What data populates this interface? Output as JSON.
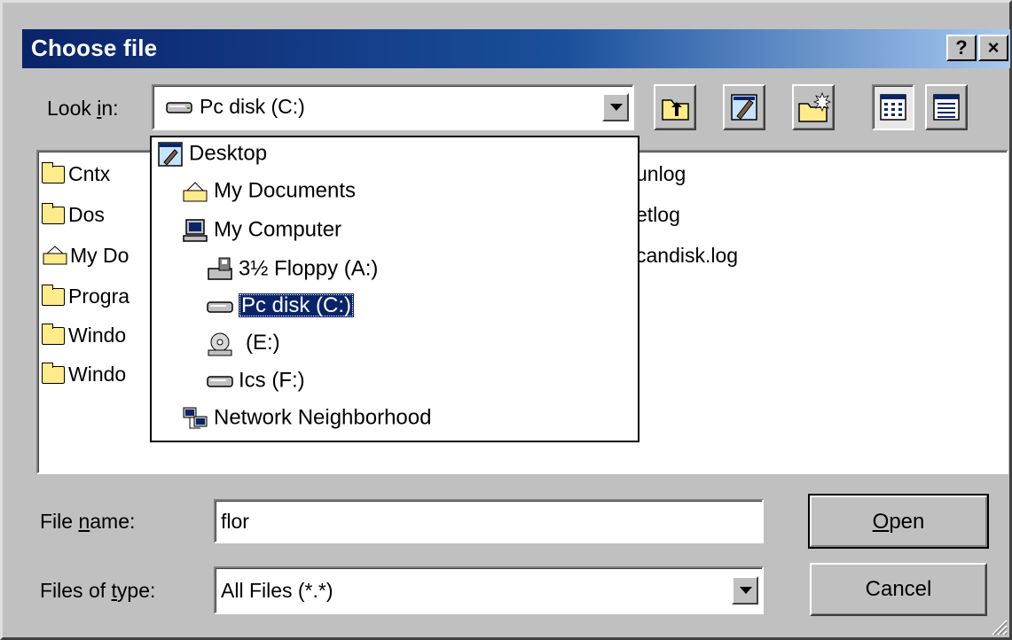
{
  "window": {
    "title": "Choose file",
    "help_label": "?",
    "close_label": "×"
  },
  "lookin": {
    "label_prefix": "Look ",
    "label_accel": "i",
    "label_suffix": "n:",
    "value": "Pc disk (C:)"
  },
  "files": [
    {
      "name": "Cntx",
      "icon": "folder-icon"
    },
    {
      "name": "Dos",
      "icon": "folder-icon"
    },
    {
      "name": "My Do",
      "icon": "my-documents-icon"
    },
    {
      "name": "Progra",
      "icon": "folder-icon"
    },
    {
      "name": "Windo",
      "icon": "folder-icon"
    },
    {
      "name": "Windo",
      "icon": "folder-icon"
    }
  ],
  "files_right": [
    "unlog",
    "etlog",
    "candisk.log"
  ],
  "dropdown": [
    {
      "name": "Desktop",
      "icon": "desktop-icon"
    },
    {
      "name": "My Documents",
      "icon": "my-documents-icon"
    },
    {
      "name": "My Computer",
      "icon": "my-computer-icon"
    },
    {
      "name": "3½ Floppy (A:)",
      "icon": "floppy-icon"
    },
    {
      "name": "Pc disk (C:)",
      "icon": "hard-disk-icon",
      "selected": true
    },
    {
      "name": "(E:)",
      "icon": "cd-drive-icon"
    },
    {
      "name": "Ics (F:)",
      "icon": "hard-disk-icon"
    },
    {
      "name": "Network Neighborhood",
      "icon": "network-icon"
    }
  ],
  "filename": {
    "label_prefix": "File ",
    "label_accel": "n",
    "label_suffix": "ame:",
    "value": "flor"
  },
  "filetype": {
    "label_prefix": "Files of ",
    "label_accel": "t",
    "label_suffix": "ype:",
    "value": "All Files (*.*)"
  },
  "buttons": {
    "open_accel": "O",
    "open_rest": "pen",
    "cancel": "Cancel"
  },
  "colors": {
    "titlebar_start": "#0a246a",
    "titlebar_end": "#a6caf0",
    "selection": "#0a246a"
  }
}
